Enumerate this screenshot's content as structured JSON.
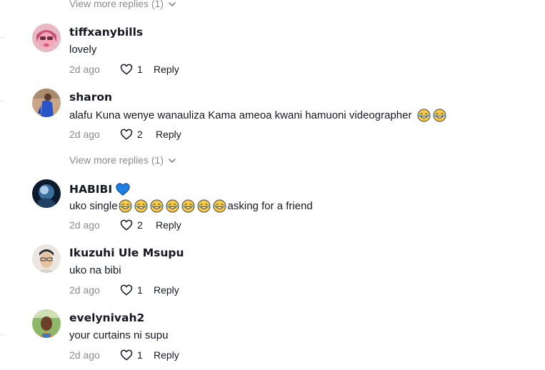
{
  "view_more_label": "View more replies (1)",
  "comments": [
    {
      "username": "tiffxanybills",
      "text": "lovely",
      "time": "2d ago",
      "likes": "1",
      "reply_label": "Reply",
      "avatar": "pink-haired-avatar"
    },
    {
      "username": "sharon",
      "text": "alafu Kuna wenye wanauliza Kama ameoa kwani hamuoni videographer",
      "emojis": [
        "laughing-tears-emoji",
        "laughing-tears-emoji"
      ],
      "time": "2d ago",
      "likes": "2",
      "reply_label": "Reply",
      "avatar": "woman-blue-dress-avatar"
    },
    {
      "username": "HABIBI",
      "badge": "blue-heart-icon",
      "text_before": "uko single",
      "emojis": [
        "laughing-tears-emoji",
        "laughing-tears-emoji",
        "laughing-tears-emoji",
        "laughing-tears-emoji",
        "laughing-tears-emoji",
        "laughing-tears-emoji",
        "laughing-tears-emoji"
      ],
      "text_after": "asking for a friend",
      "time": "2d ago",
      "likes": "2",
      "reply_label": "Reply",
      "avatar": "dark-blue-abstract-avatar"
    },
    {
      "username": "Ikuzuhi Ule Msupu",
      "text": "uko na bibi",
      "time": "2d ago",
      "likes": "1",
      "reply_label": "Reply",
      "avatar": "man-glasses-avatar"
    },
    {
      "username": "evelynivah2",
      "text": "your curtains ni supu",
      "time": "2d ago",
      "likes": "1",
      "reply_label": "Reply",
      "avatar": "woman-outdoor-avatar"
    }
  ],
  "colors": {
    "text": "#161823",
    "muted": "#8a8b91",
    "badge_blue": "#1f7ee0",
    "emoji_yellow": "#f7c948"
  }
}
